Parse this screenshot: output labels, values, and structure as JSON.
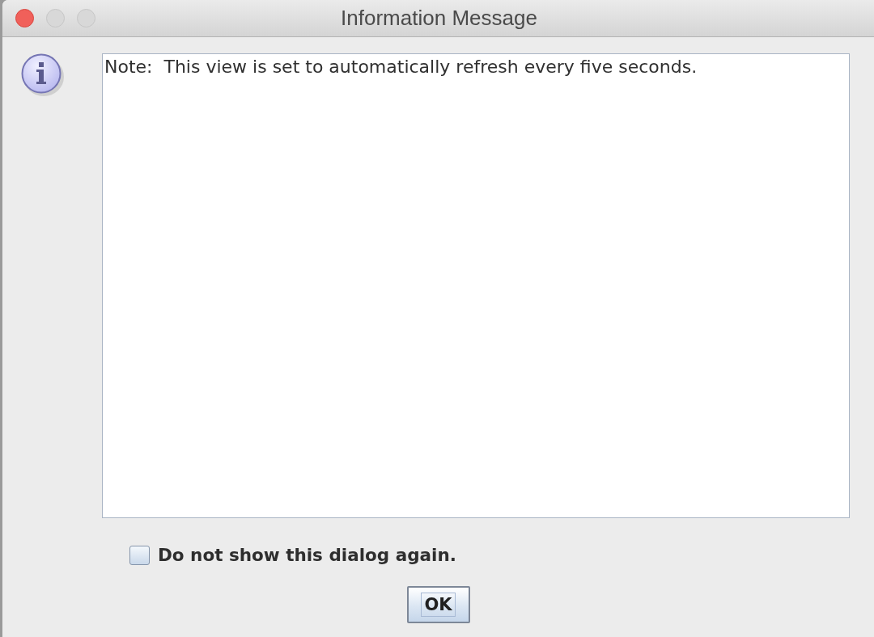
{
  "window": {
    "title": "Information Message",
    "window_buttons": [
      {
        "kind": "close",
        "disabled": false
      },
      {
        "kind": "minimize",
        "disabled": true
      },
      {
        "kind": "zoom",
        "disabled": true
      }
    ]
  },
  "message": {
    "text": "Note:  This view is set to automatically refresh every five seconds."
  },
  "checkbox": {
    "label": "Do not show this dialog again.",
    "checked": false
  },
  "buttons": [
    {
      "label": "OK",
      "focused": true
    }
  ]
}
